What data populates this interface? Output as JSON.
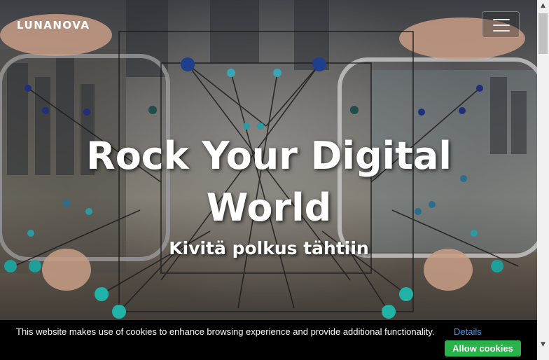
{
  "navbar": {
    "brand": "LUNANOVA",
    "menu_icon": "hamburger-menu-icon"
  },
  "hero": {
    "headline": "Rock Your Digital World",
    "subheadline": "Kivitä polkus tähtiin"
  },
  "cookie_banner": {
    "message": "This website makes use of cookies to enhance browsing experience and provide additional functionality.",
    "details_link": "Details",
    "allow_button": "Allow cookies"
  },
  "scrollbar": {
    "up_icon": "scroll-up-arrow-icon",
    "down_icon": "scroll-down-arrow-icon"
  },
  "colors": {
    "cookie_bar_bg": "#000000",
    "details_link": "#3b9df0",
    "allow_button": "#2ab14a",
    "text": "#ffffff"
  }
}
